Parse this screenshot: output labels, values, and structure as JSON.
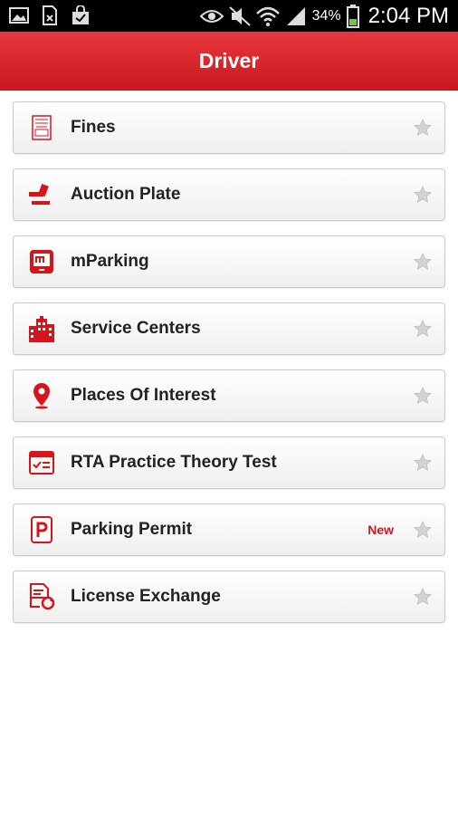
{
  "status_bar": {
    "battery_percent": "34%",
    "time": "2:04 PM",
    "left_icons": [
      "gallery-icon",
      "sim-icon",
      "shopping-bag-icon"
    ],
    "right_icons": [
      "eye-icon",
      "mute-icon",
      "wifi-icon",
      "signal-icon",
      "battery-icon"
    ]
  },
  "app_bar": {
    "title": "Driver"
  },
  "items": [
    {
      "label": "Fines",
      "icon": "fine-ticket-icon"
    },
    {
      "label": "Auction Plate",
      "icon": "gavel-icon"
    },
    {
      "label": "mParking",
      "icon": "mparking-icon"
    },
    {
      "label": "Service Centers",
      "icon": "buildings-icon"
    },
    {
      "label": "Places Of Interest",
      "icon": "map-pin-icon"
    },
    {
      "label": "RTA Practice Theory Test",
      "icon": "test-window-icon"
    },
    {
      "label": "Parking Permit",
      "icon": "parking-icon",
      "badge": "New"
    },
    {
      "label": "License Exchange",
      "icon": "license-exchange-icon"
    }
  ],
  "colors": {
    "accent": "#d8141b",
    "header": "#d82027",
    "star": "#c8c8c8"
  }
}
